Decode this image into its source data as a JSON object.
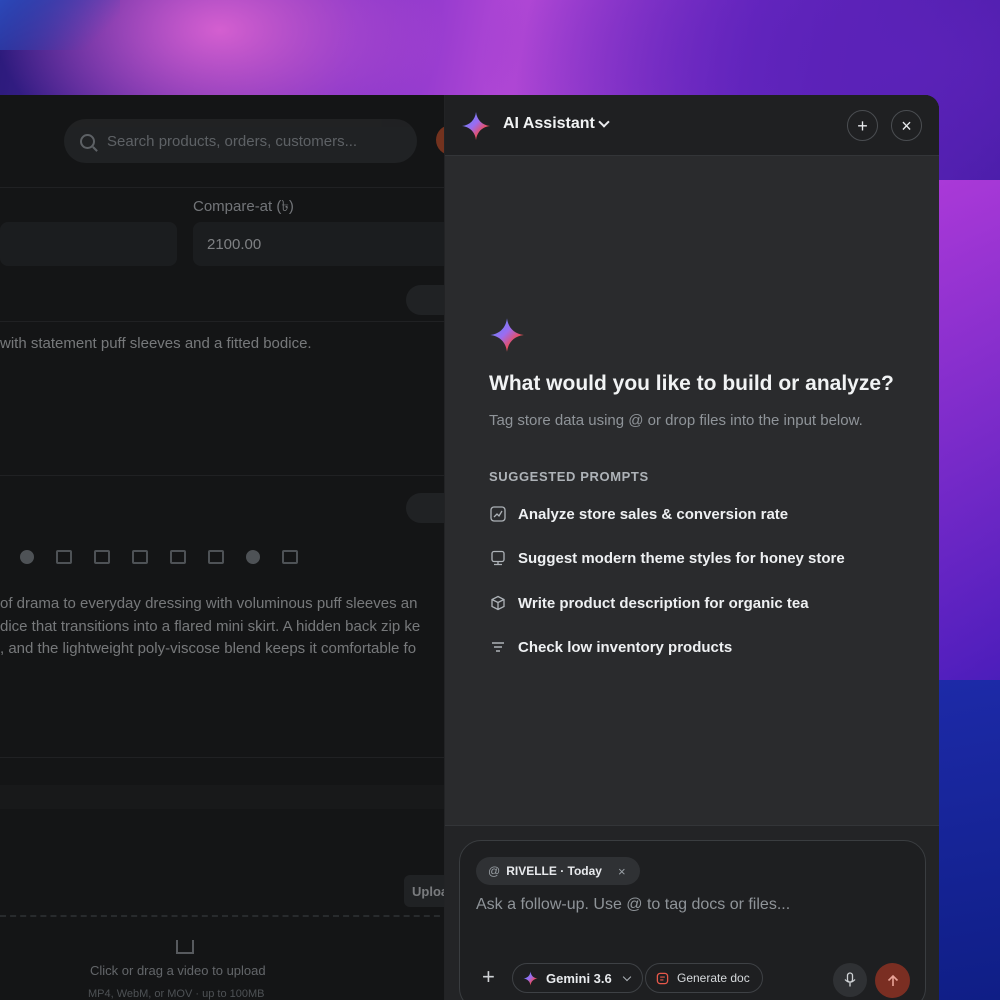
{
  "background_app": {
    "search_placeholder": "Search products, orders, customers...",
    "compare_at_label": "Compare-at (৳)",
    "compare_at_value": "2100.00",
    "short_desc": "with statement puff sleeves and a fitted bodice.",
    "long_desc_lines": [
      "of drama to everyday dressing with voluminous puff sleeves an",
      "dice that transitions into a flared mini skirt. A hidden back zip ke",
      ", and the lightweight poly-viscose blend keeps it comfortable fo"
    ],
    "upload_button": "Uploa",
    "upload_text": "Click or drag a video to upload",
    "upload_sub": "MP4, WebM, or MOV · up to 100MB"
  },
  "panel": {
    "title": "AI Assistant",
    "new_chat_glyph": "+",
    "close_glyph": "×",
    "heading": "What would you like to build or analyze?",
    "subheading": "Tag store data using @ or drop files into the input below.",
    "suggested_label": "SUGGESTED PROMPTS",
    "prompts": [
      {
        "label": "Analyze store sales & conversion rate",
        "icon": "chart-icon"
      },
      {
        "label": "Suggest modern theme styles for honey store",
        "icon": "theme-icon"
      },
      {
        "label": "Write product description for organic tea",
        "icon": "box-icon"
      },
      {
        "label": "Check low inventory products",
        "icon": "filter-icon"
      }
    ]
  },
  "composer": {
    "context_chip": "RIVELLE · Today",
    "at_symbol": "@",
    "chip_close": "×",
    "placeholder": "Ask a follow-up. Use @ to tag docs or files...",
    "attach_glyph": "+",
    "model": "Gemini 3.6",
    "generate_doc": "Generate doc"
  },
  "colors": {
    "panel_bg": "#2a2b2d",
    "header_bg": "#1f2022",
    "send_button": "#7a2e22"
  }
}
